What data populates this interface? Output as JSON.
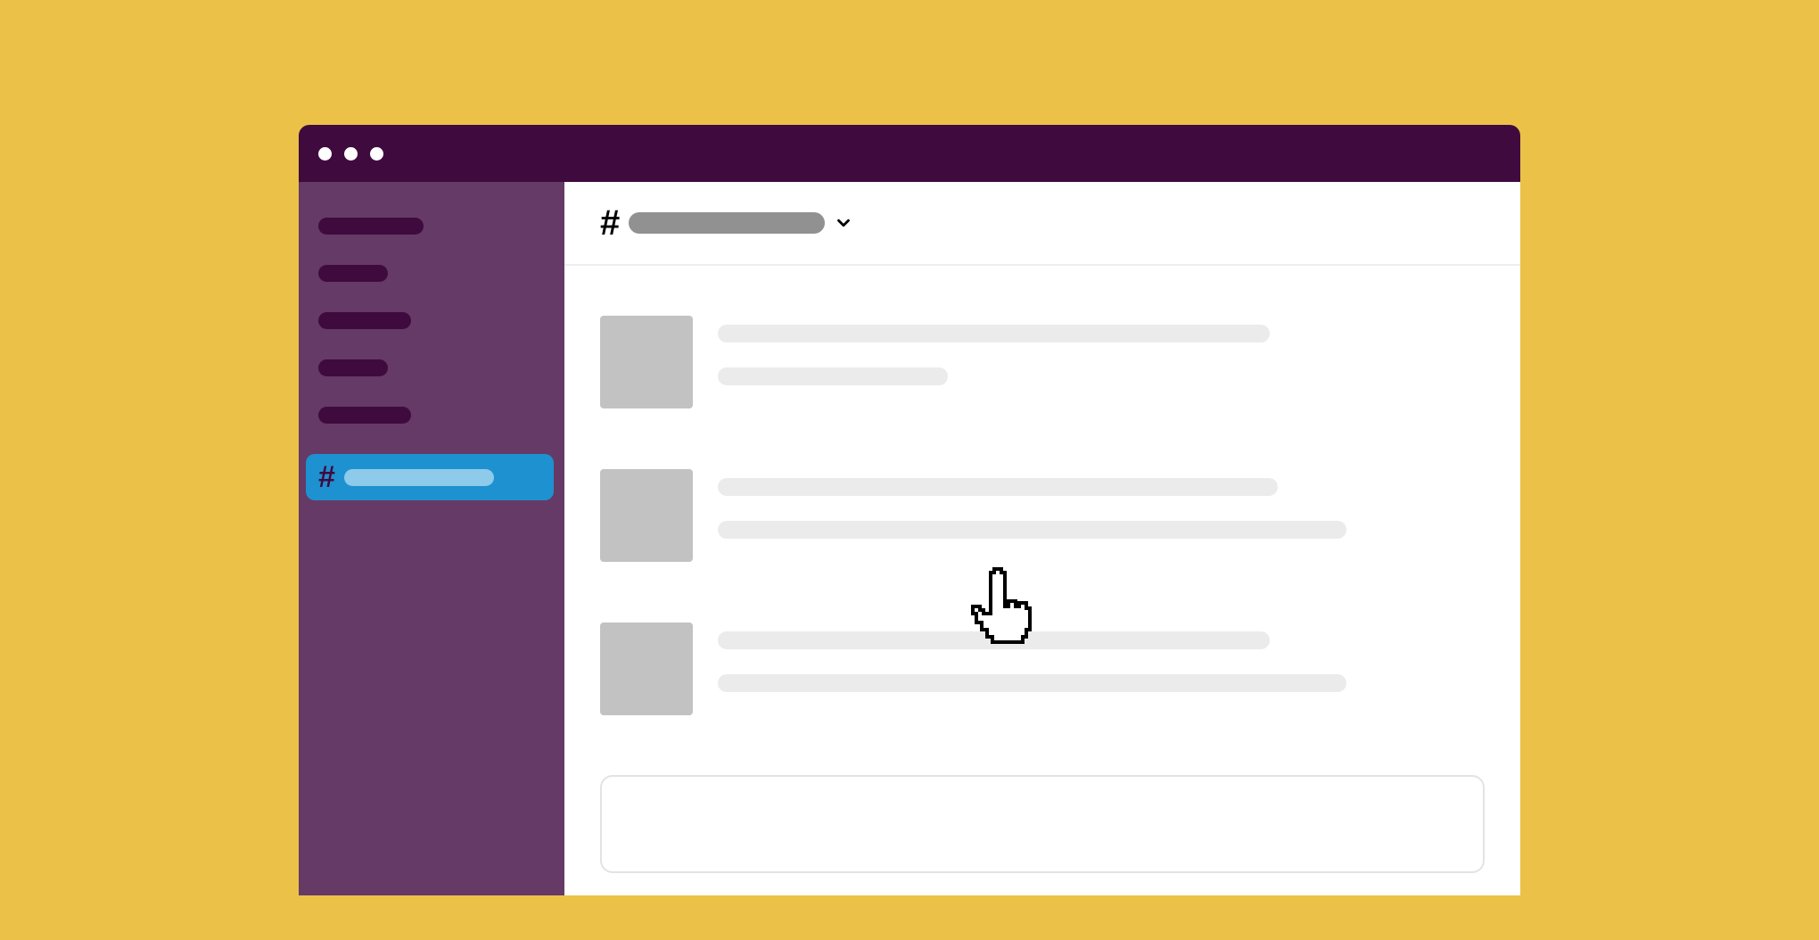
{
  "colors": {
    "page_bg": "#ebc247",
    "titlebar_bg": "#3f0b3f",
    "sidebar_bg": "#653a66",
    "sidebar_item": "#3f0b3f",
    "active_bg": "#1e91d0",
    "active_pill": "#8ecae9",
    "channel_pill": "#919191",
    "avatar": "#c2c2c2",
    "line": "#ebebeb",
    "border": "#e3e3e3"
  },
  "window": {
    "traffic_lights": 3
  },
  "sidebar": {
    "items": [
      {
        "label": ""
      },
      {
        "label": ""
      },
      {
        "label": ""
      },
      {
        "label": ""
      },
      {
        "label": ""
      }
    ],
    "active_channel": {
      "icon": "hash-icon",
      "label": ""
    }
  },
  "header": {
    "icon": "hash-icon",
    "channel_name": "",
    "has_dropdown": true
  },
  "messages": [
    {
      "avatar": "",
      "lines": [
        "",
        ""
      ]
    },
    {
      "avatar": "",
      "lines": [
        "",
        ""
      ]
    },
    {
      "avatar": "",
      "lines": [
        "",
        ""
      ]
    }
  ],
  "compose": {
    "placeholder": "",
    "value": ""
  },
  "cursor": {
    "type": "hand-pointer",
    "visible": true
  }
}
